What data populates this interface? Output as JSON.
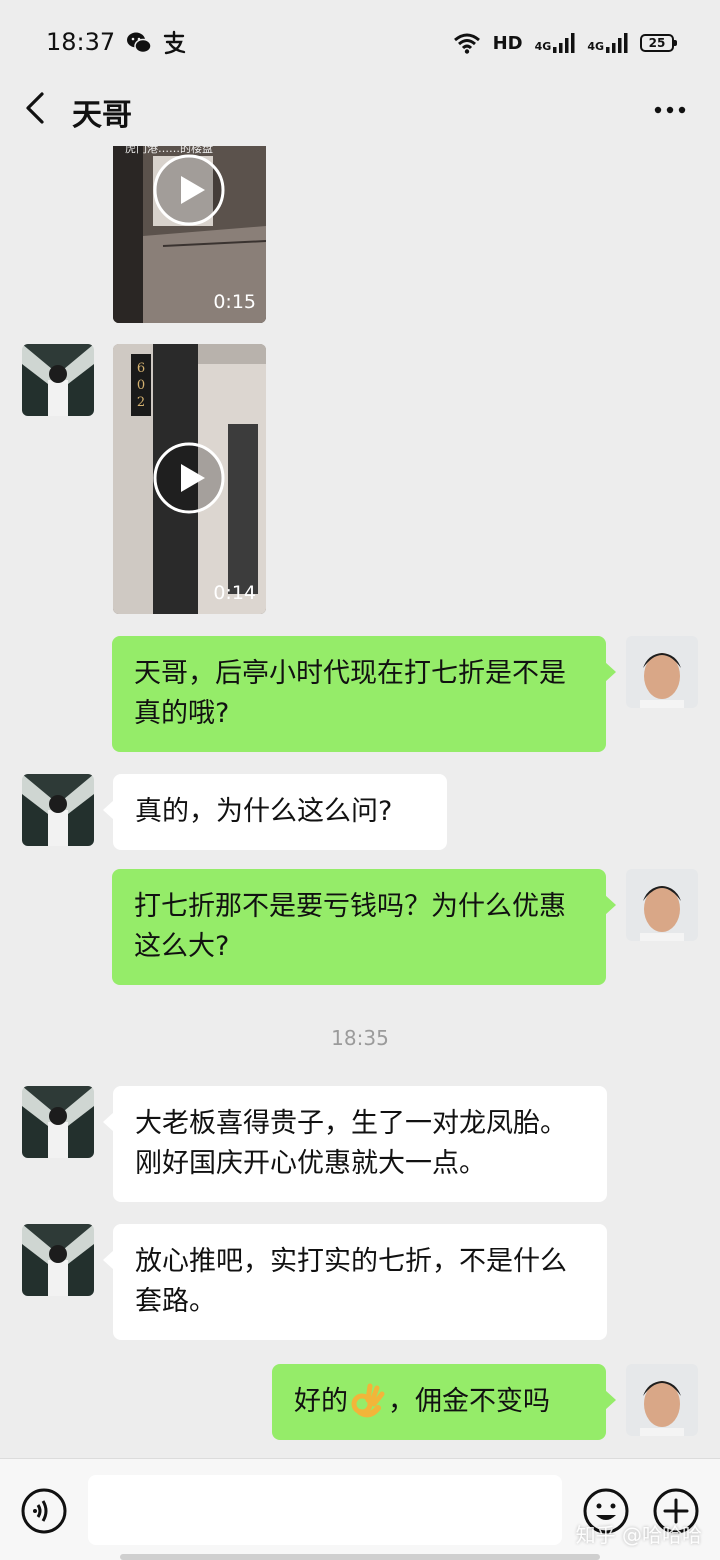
{
  "status_bar": {
    "time": "18:37",
    "network_label": "HD",
    "signal1_label": "4G",
    "signal2_label": "4G",
    "battery": "25"
  },
  "header": {
    "title": "天哥"
  },
  "messages": {
    "video1": {
      "duration": "0:15",
      "caption": "虎门港……的楼盘"
    },
    "video2": {
      "duration": "0:14"
    },
    "msg1": "天哥，后亭小时代现在打七折是不是真的哦?",
    "msg2": "真的，为什么这么问?",
    "msg3": "打七折那不是要亏钱吗？为什么优惠这么大?",
    "timestamp": "18:35",
    "msg4": "大老板喜得贵子，生了一对龙凤胎。刚好国庆开心优惠就大一点。",
    "msg5": "放心推吧，实打实的七折，不是什么套路。",
    "msg6_prefix": "好的",
    "msg6_suffix": "，佣金不变吗"
  },
  "input": {
    "value": ""
  },
  "watermark": "知乎 @哈哈哈",
  "colors": {
    "background": "#ededed",
    "my_bubble": "#95ec69",
    "other_bubble": "#ffffff"
  }
}
